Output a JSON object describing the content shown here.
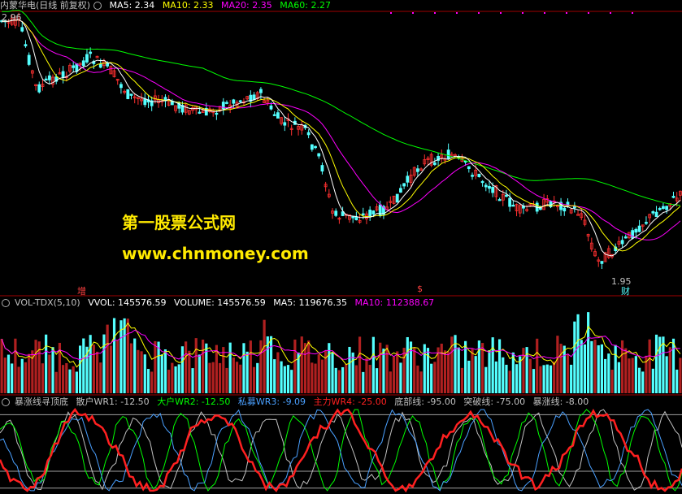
{
  "main": {
    "title": "内蒙华电(日线 前复权)",
    "ma5": "MA5: 2.34",
    "ma10": "MA10: 2.33",
    "ma20": "MA20: 2.35",
    "ma60": "MA60: 2.27",
    "high_label": "2.96",
    "low_label": "1.95",
    "mark_zeng": "增",
    "mark_dollar": "$",
    "mark_cai": "财",
    "colors": {
      "ma5": "#ffffff",
      "ma10": "#ffff00",
      "ma20": "#ff00ff",
      "ma60": "#00ff00",
      "up": "#ff3030",
      "down": "#54ffff"
    }
  },
  "watermark": {
    "line1": "第一股票公式网",
    "line2": "www.chnmoney.com"
  },
  "volume": {
    "title": "VOL-TDX(5,10)",
    "vvol": "VVOL: 145576.59",
    "volume": "VOLUME: 145576.59",
    "ma5": "MA5: 119676.35",
    "ma10": "MA10: 112388.67"
  },
  "wr": {
    "title": "暴涨线寻顶底",
    "wr1": "散户WR1: -12.50",
    "wr2": "大户WR2: -12.50",
    "wr3": "私募WR3: -9.09",
    "wr4": "主力WR4: -25.00",
    "bottom": "底部线: -95.00",
    "break": "突破线: -75.00",
    "surge": "暴涨线: -8.00"
  }
}
